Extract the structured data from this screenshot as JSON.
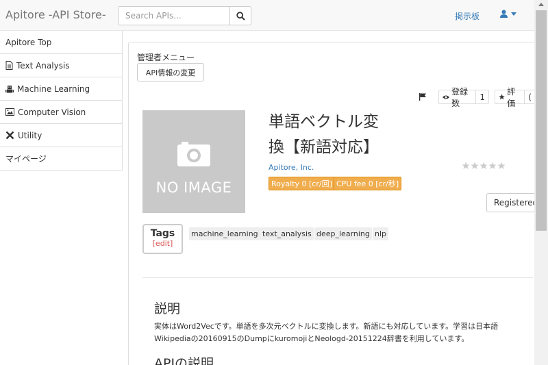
{
  "navbar": {
    "brand": "Apitore -API Store-",
    "search_placeholder": "Search APIs...",
    "forum_link": "掲示板"
  },
  "sidebar": {
    "items": [
      {
        "label": "Apitore Top",
        "icon": "none"
      },
      {
        "label": "Text Analysis",
        "icon": "file-text-icon"
      },
      {
        "label": "Machine Learning",
        "icon": "robot-icon"
      },
      {
        "label": "Computer Vision",
        "icon": "picture-icon"
      },
      {
        "label": "Utility",
        "icon": "wrench-icon"
      },
      {
        "label": "マイページ",
        "icon": "none"
      }
    ]
  },
  "admin": {
    "menu_label": "管理者メニュー",
    "edit_button": "API情報の変更"
  },
  "stats": {
    "registered_label": "登録数",
    "registered_count": "1",
    "rating_label": "評価",
    "rating_count": "("
  },
  "api": {
    "image_text": "NO IMAGE",
    "title_line1": "単語ベクトル変",
    "title_line2": "換【新語対応】",
    "owner": "Apitore, Inc.",
    "royalty": "Royalty 0 [cr/回]",
    "cpu_fee": "CPU fee 0 [cr/秒]",
    "star_rating": 0,
    "registered_button": "Registered"
  },
  "tags": {
    "title": "Tags",
    "edit": "[edit]",
    "items": [
      "machine_learning",
      "text_analysis",
      "deep_learning",
      "nlp"
    ]
  },
  "content": {
    "description_heading": "説明",
    "description_text": "実体はWord2Vecです。単語を多次元ベクトルに変換します。新語にも対応しています。学習は日本語Wikipediaの20160915のDumpにkuromojiとNeologd-20151224辞書を利用しています。",
    "api_heading": "APIの説明"
  },
  "colors": {
    "link": "#337ab7",
    "badge": "#f0ad4e",
    "edit_red": "#d9534f",
    "noimage_bg": "#c9c9c9"
  }
}
